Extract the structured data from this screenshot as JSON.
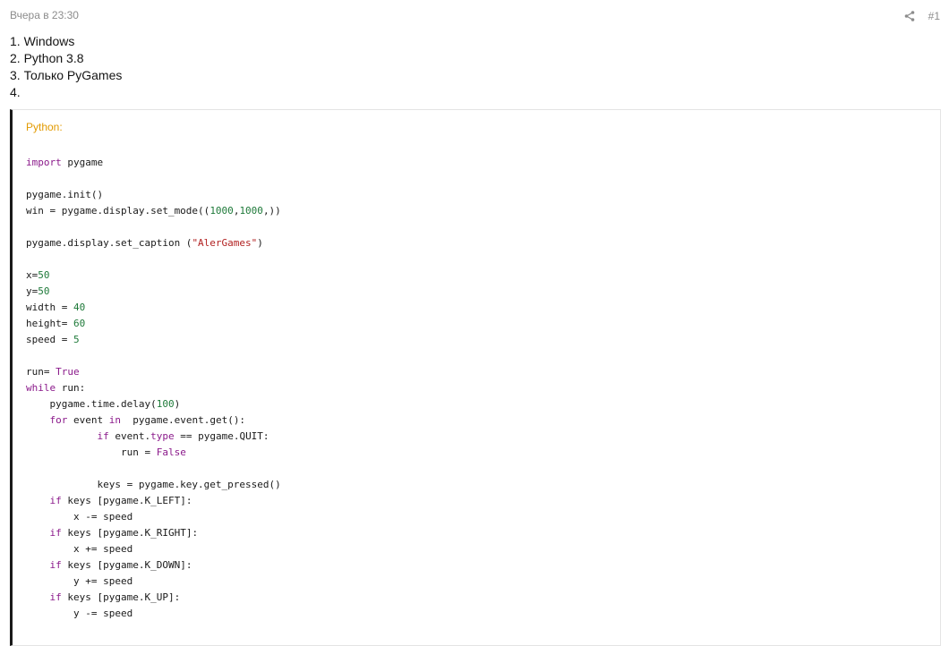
{
  "post": {
    "date": "Вчера в 23:30",
    "number": "#1",
    "share_icon": "share-icon"
  },
  "message": {
    "lines": [
      "1. Windows",
      "2. Python 3.8",
      "3. Только PyGames",
      "4."
    ]
  },
  "code": {
    "language": "Python:",
    "lines": [
      [
        [
          "kw",
          "import"
        ],
        [
          "t",
          " pygame"
        ]
      ],
      [],
      [
        [
          "t",
          "pygame.init()"
        ]
      ],
      [
        [
          "t",
          "win = pygame.display.set_mode(("
        ],
        [
          "num",
          "1000"
        ],
        [
          "t",
          ","
        ],
        [
          "num",
          "1000"
        ],
        [
          "t",
          ",))"
        ]
      ],
      [],
      [
        [
          "t",
          "pygame.display.set_caption ("
        ],
        [
          "str",
          "\"AlerGames\""
        ],
        [
          "t",
          ")"
        ]
      ],
      [],
      [
        [
          "t",
          "x="
        ],
        [
          "num",
          "50"
        ]
      ],
      [
        [
          "t",
          "y="
        ],
        [
          "num",
          "50"
        ]
      ],
      [
        [
          "t",
          "width = "
        ],
        [
          "num",
          "40"
        ]
      ],
      [
        [
          "t",
          "height= "
        ],
        [
          "num",
          "60"
        ]
      ],
      [
        [
          "t",
          "speed = "
        ],
        [
          "num",
          "5"
        ]
      ],
      [],
      [
        [
          "t",
          "run= "
        ],
        [
          "const",
          "True"
        ]
      ],
      [
        [
          "kw",
          "while"
        ],
        [
          "t",
          " run:"
        ]
      ],
      [
        [
          "t",
          "    pygame.time.delay("
        ],
        [
          "num",
          "100"
        ],
        [
          "t",
          ")"
        ]
      ],
      [
        [
          "t",
          "    "
        ],
        [
          "kw",
          "for"
        ],
        [
          "t",
          " event "
        ],
        [
          "kw",
          "in"
        ],
        [
          "t",
          "  pygame.event.get():"
        ]
      ],
      [
        [
          "t",
          "            "
        ],
        [
          "kw",
          "if"
        ],
        [
          "t",
          " event."
        ],
        [
          "kw",
          "type"
        ],
        [
          "t",
          " == pygame.QUIT:"
        ]
      ],
      [
        [
          "t",
          "                run = "
        ],
        [
          "const",
          "False"
        ]
      ],
      [],
      [
        [
          "t",
          "            keys = pygame.key.get_pressed()"
        ]
      ],
      [
        [
          "t",
          "    "
        ],
        [
          "kw",
          "if"
        ],
        [
          "t",
          " keys [pygame.K_LEFT]:"
        ]
      ],
      [
        [
          "t",
          "        x -= speed"
        ]
      ],
      [
        [
          "t",
          "    "
        ],
        [
          "kw",
          "if"
        ],
        [
          "t",
          " keys [pygame.K_RIGHT]:"
        ]
      ],
      [
        [
          "t",
          "        x += speed"
        ]
      ],
      [
        [
          "t",
          "    "
        ],
        [
          "kw",
          "if"
        ],
        [
          "t",
          " keys [pygame.K_DOWN]:"
        ]
      ],
      [
        [
          "t",
          "        y += speed"
        ]
      ],
      [
        [
          "t",
          "    "
        ],
        [
          "kw",
          "if"
        ],
        [
          "t",
          " keys [pygame.K_UP]:"
        ]
      ],
      [
        [
          "t",
          "        y -= speed"
        ]
      ]
    ]
  },
  "colors": {
    "keyword": "#8b1a8b",
    "number": "#1f7a3a",
    "string": "#b22222",
    "title": "#e29a00"
  }
}
